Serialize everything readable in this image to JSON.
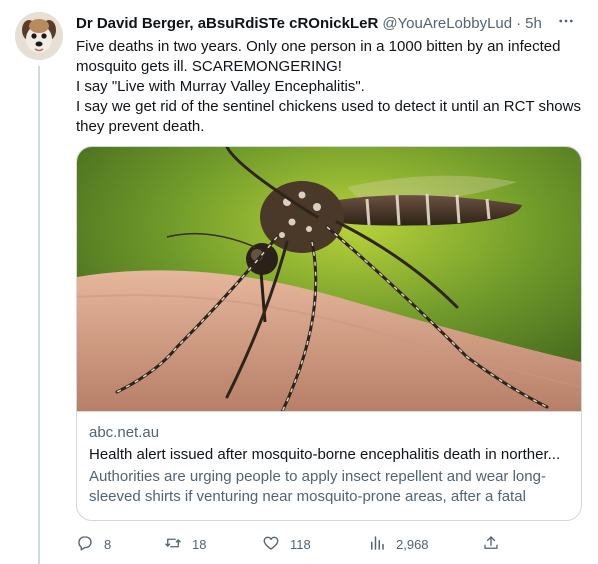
{
  "author": {
    "display_name": "Dr David Berger, aBsuRdiSTe cROnickLeR",
    "handle": "@YouAreLobbyLud",
    "separator": "·",
    "time": "5h"
  },
  "tweet": {
    "lines": [
      "Five deaths in two years. Only one person in a 1000 bitten by an infected",
      "mosquito gets ill. SCAREMONGERING!",
      "I say \"Live with Murray Valley Encephalitis\".",
      "I say we get rid of the sentinel chickens used to detect it until an RCT shows",
      "they prevent death."
    ]
  },
  "card": {
    "domain": "abc.net.au",
    "title": "Health alert issued after mosquito-borne encephalitis death in norther...",
    "description": "Authorities are urging people to apply insect repellent and wear long-sleeved shirts if venturing near mosquito-prone areas, after a fatal case..."
  },
  "actions": {
    "replies": "8",
    "retweets": "18",
    "likes": "118",
    "views": "2,968"
  },
  "icons": {
    "more": "more-dots-icon",
    "reply": "reply-bubble-icon",
    "retweet": "retweet-icon",
    "like": "heart-icon",
    "views": "analytics-bars-icon",
    "share": "share-upload-icon"
  },
  "colors": {
    "text": "#0f1419",
    "secondary": "#536471",
    "border": "#cfd9de"
  }
}
